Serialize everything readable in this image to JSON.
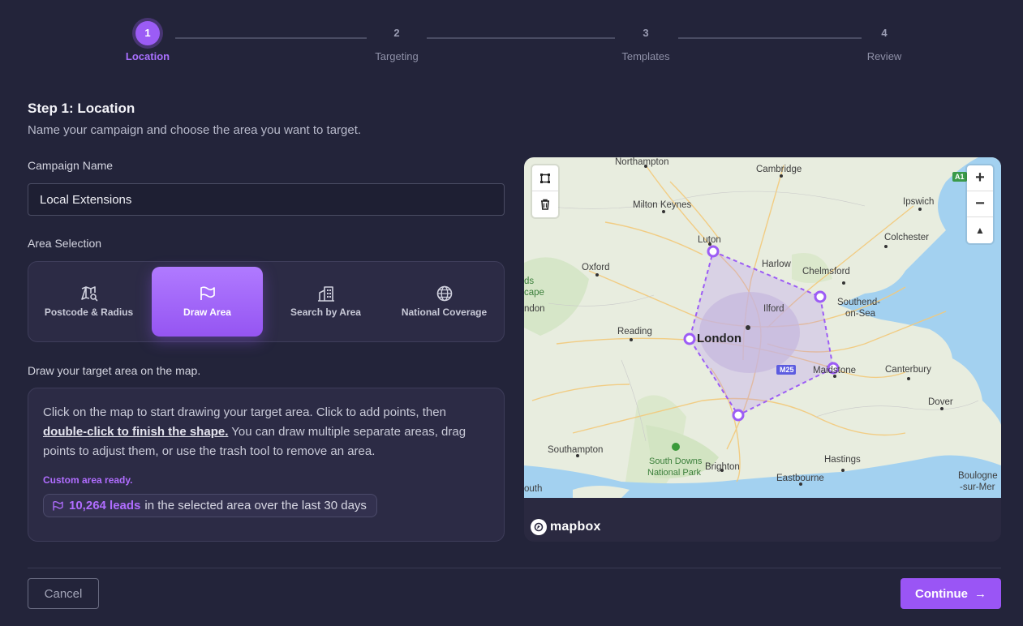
{
  "stepper": {
    "steps": [
      {
        "num": "1",
        "label": "Location"
      },
      {
        "num": "2",
        "label": "Targeting"
      },
      {
        "num": "3",
        "label": "Templates"
      },
      {
        "num": "4",
        "label": "Review"
      }
    ]
  },
  "header": {
    "title": "Step 1: Location",
    "subtitle": "Name your campaign and choose the area you want to target."
  },
  "campaign": {
    "label": "Campaign Name",
    "value": "Local Extensions"
  },
  "area": {
    "label": "Area Selection",
    "options": [
      {
        "label": "Postcode & Radius",
        "icon": "map-search-icon"
      },
      {
        "label": "Draw Area",
        "icon": "draw-flag-icon"
      },
      {
        "label": "Search by Area",
        "icon": "buildings-icon"
      },
      {
        "label": "National Coverage",
        "icon": "globe-icon"
      }
    ],
    "selected": "Draw Area"
  },
  "draw": {
    "label": "Draw your target area on the map.",
    "instructions_pre": "Click on the map to start drawing your target area. Click to add points, then",
    "instructions_strong": "double-click to finish the shape.",
    "instructions_post": "You can draw multiple separate areas, drag points to adjust them, or use the trash tool to remove an area.",
    "status": "Custom area ready.",
    "leads_count": "10,264 leads",
    "leads_suffix": "in the selected area over the last 30 days"
  },
  "map": {
    "labels": {
      "northampton": "Northampton",
      "cambridge": "Cambridge",
      "ipswich": "Ipswich",
      "milton_keynes": "Milton Keynes",
      "luton": "Luton",
      "colchester": "Colchester",
      "oxford": "Oxford",
      "harlow": "Harlow",
      "chelmsford": "Chelmsford",
      "southend": "Southend-",
      "southend2": "on-Sea",
      "ilford": "Ilford",
      "reading": "Reading",
      "london": "London",
      "maidstone": "Maidstone",
      "canterbury": "Canterbury",
      "dover": "Dover",
      "southampton": "Southampton",
      "south_downs": "South Downs",
      "national_park": "National Park",
      "brighton": "Brighton",
      "hastings": "Hastings",
      "eastbourne": "Eastbourne",
      "boulogne": "Boulogne",
      "sur_mer": "-sur-Mer",
      "road_m25": "M25",
      "road_a1": "A1",
      "left1": "ds",
      "left2": "cape",
      "left3": "ndon",
      "left4": "outh"
    },
    "zoom_in": "+",
    "zoom_out": "−",
    "compass": "▲",
    "attribution": "mapbox"
  },
  "footer": {
    "cancel": "Cancel",
    "continue": "Continue",
    "continue_arrow": "→"
  },
  "colors": {
    "accent": "#9b5cf5",
    "background": "#23243a",
    "water": "#a3d1f0",
    "land": "#e8eddf"
  }
}
